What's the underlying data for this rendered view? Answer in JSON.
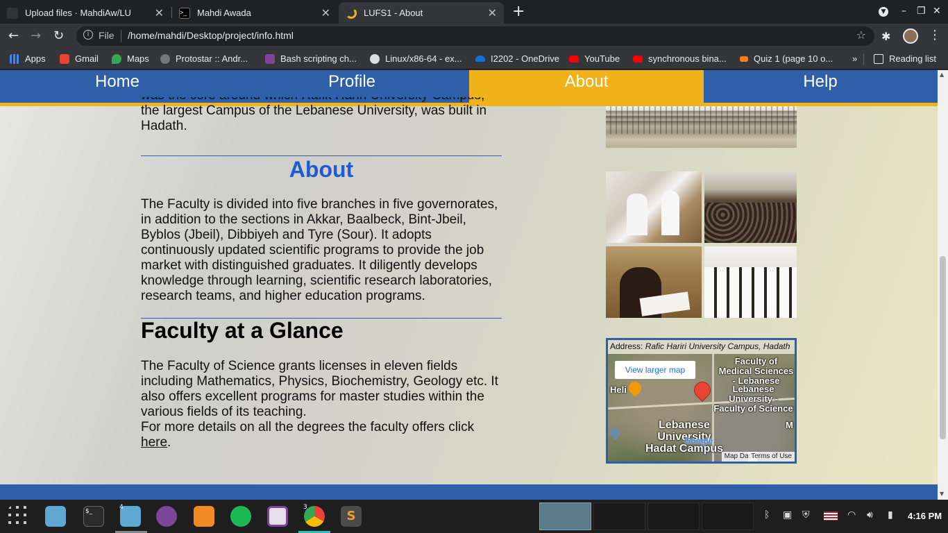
{
  "browser": {
    "tabs": [
      {
        "title": "Upload files · MahdiAw/LU",
        "active": false
      },
      {
        "title": "Mahdi Awada",
        "active": false
      },
      {
        "title": "LUFS1 - About",
        "active": true
      }
    ],
    "omnibox": {
      "scheme_label": "File",
      "url": "/home/mahdi/Desktop/project/info.html"
    },
    "bookmarks": [
      {
        "label": "Apps",
        "icon": "apps-grid-icon"
      },
      {
        "label": "Gmail",
        "icon": "gmail-icon"
      },
      {
        "label": "Maps",
        "icon": "maps-icon"
      },
      {
        "label": "Protostar :: Andr...",
        "icon": "globe-icon"
      },
      {
        "label": "Bash scripting ch...",
        "icon": "tor-icon"
      },
      {
        "label": "Linux/x86-64 - ex...",
        "icon": "exploit-icon"
      },
      {
        "label": "I2202 - OneDrive",
        "icon": "onedrive-icon"
      },
      {
        "label": "YouTube",
        "icon": "youtube-icon"
      },
      {
        "label": "synchronous bina...",
        "icon": "youtube-icon"
      },
      {
        "label": "Quiz 1 (page 10 o...",
        "icon": "moodle-icon"
      }
    ],
    "reading_list": "Reading list"
  },
  "site": {
    "nav": [
      "Home",
      "Profile",
      "About",
      "Help"
    ],
    "active_nav": "About",
    "intro_partial": "was the core around which Rafik Hariri University Campus, the largest Campus of the Lebanese University, was built in Hadath.",
    "about_heading": "About",
    "about_text": "The Faculty is divided into five branches in five governorates, in addition to the sections in Akkar, Baalbeck, Bint-Jbeil, Byblos (Jbeil), Dibbiyeh and Tyre (Sour). It adopts continuously updated scientific programs to provide the job market with distinguished graduates. It diligently develops knowledge through learning, scientific research laboratories, research teams, and higher education programs.",
    "glance_heading": "Faculty at a Glance",
    "glance_text": "The Faculty of Science grants licenses in eleven fields including Mathematics, Physics, Biochemistry, Geology etc. It also offers excellent programs for master studies within the various fields of its teaching.",
    "details_text": "For more details on all the degrees the faculty offers click ",
    "details_link": "here",
    "details_end": ".",
    "map": {
      "address_label": "Address: ",
      "address": "Rafic Hariri University Campus, Hadath",
      "larger_map": "View larger map",
      "labels": {
        "medical": "Faculty of Medical Sciences - Lebanese",
        "science": "Lebanese University - Faculty of Science",
        "heli": "Heli",
        "campus": "Lebanese University Hadat Campus",
        "m": "M",
        "google": "Google"
      },
      "map_data": "Map Data",
      "terms": "Terms of Use"
    }
  },
  "taskbar": {
    "clock": "4:16 PM",
    "badges": {
      "files": "4",
      "chrome": "3"
    }
  }
}
